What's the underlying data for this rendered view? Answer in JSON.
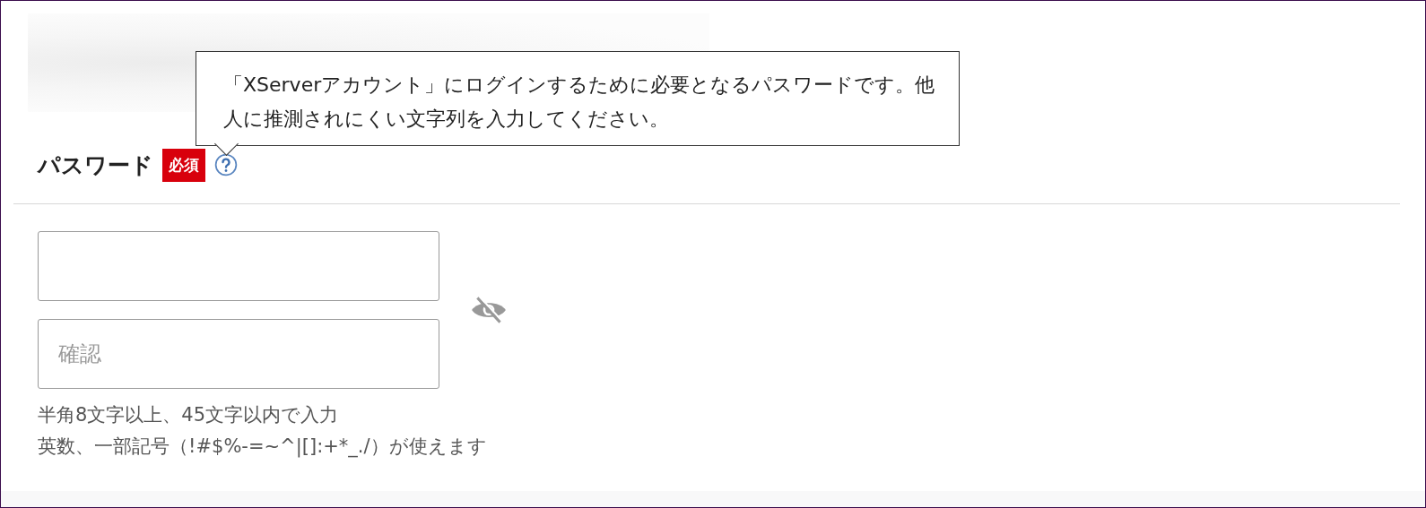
{
  "field": {
    "label": "パスワード",
    "required_badge": "必須",
    "help_tooltip": {
      "lines": [
        "「XServerアカウント」にログインするために必要となるパスワードです。他",
        "人に推測されにくい文字列を入力してください。"
      ]
    }
  },
  "confirm_input": {
    "placeholder": "確認"
  },
  "visibility_toggle": {
    "password_hidden": true
  },
  "hints": [
    "半角8文字以上、45文字以内で入力",
    "英数、一部記号（!#$%-=~^|[]:+*_./）が使えます"
  ]
}
